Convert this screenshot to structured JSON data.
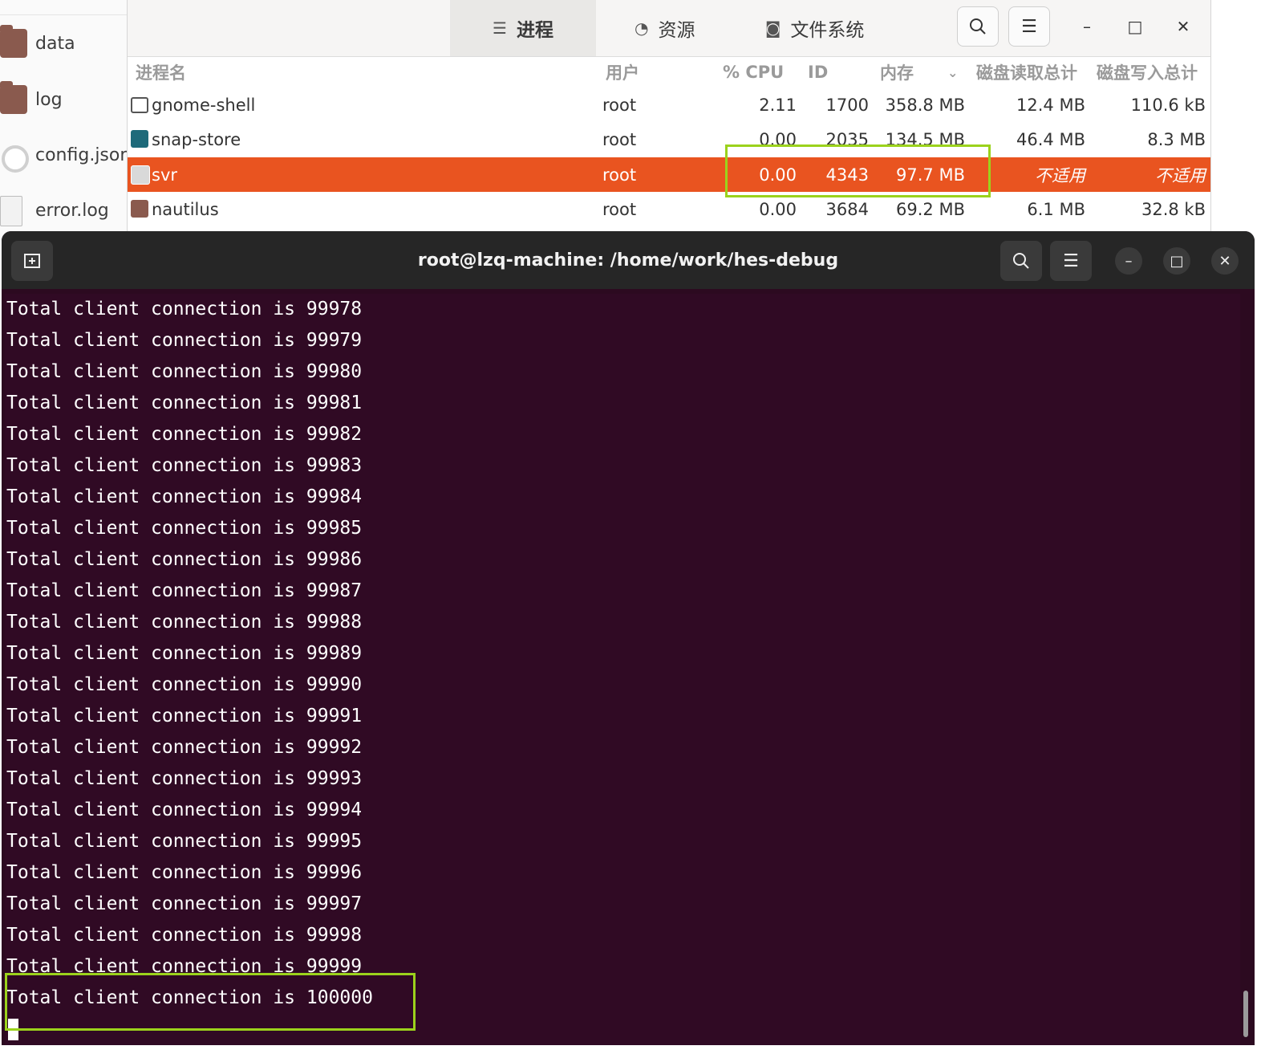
{
  "files": {
    "items": [
      {
        "name": "data",
        "icon": "folder-icon"
      },
      {
        "name": "log",
        "icon": "folder-icon"
      },
      {
        "name": "config.json",
        "icon": "json-file-icon"
      },
      {
        "name": "error.log",
        "icon": "log-file-icon"
      }
    ]
  },
  "system_monitor": {
    "tabs": [
      {
        "label": "进程",
        "icon": "list-icon",
        "active": true
      },
      {
        "label": "资源",
        "icon": "gauge-icon",
        "active": false
      },
      {
        "label": "文件系统",
        "icon": "disk-icon",
        "active": false
      }
    ],
    "buttons": {
      "search": "search-icon",
      "menu": "hamburger-menu-icon",
      "minimize": "–",
      "maximize": "□",
      "close": "✕"
    },
    "columns": {
      "name": "进程名",
      "user": "用户",
      "cpu": "% CPU",
      "id": "ID",
      "memory": "内存",
      "disk_read": "磁盘读取总计",
      "disk_write": "磁盘写入总计"
    },
    "sort_indicator": "chevron-down-icon",
    "processes": [
      {
        "name": "gnome-shell",
        "user": "root",
        "cpu": "2.11",
        "id": "1700",
        "memory": "358.8 MB",
        "disk_read": "12.4 MB",
        "disk_write": "110.6 kB",
        "selected": false
      },
      {
        "name": "snap-store",
        "user": "root",
        "cpu": "0.00",
        "id": "2035",
        "memory": "134.5 MB",
        "disk_read": "46.4 MB",
        "disk_write": "8.3 MB",
        "selected": false
      },
      {
        "name": "svr",
        "user": "root",
        "cpu": "0.00",
        "id": "4343",
        "memory": "97.7 MB",
        "disk_read": "不适用",
        "disk_write": "不适用",
        "selected": true
      },
      {
        "name": "nautilus",
        "user": "root",
        "cpu": "0.00",
        "id": "3684",
        "memory": "69.2 MB",
        "disk_read": "6.1 MB",
        "disk_write": "32.8 kB",
        "selected": false
      }
    ]
  },
  "terminal": {
    "title": "root@lzq-machine: /home/work/hes-debug",
    "buttons": {
      "new_tab": "new-tab-icon",
      "search": "search-icon",
      "menu": "hamburger-menu-icon",
      "minimize": "–",
      "maximize": "□",
      "close": "✕"
    },
    "lines": [
      "Total client connection is 99978",
      "Total client connection is 99979",
      "Total client connection is 99980",
      "Total client connection is 99981",
      "Total client connection is 99982",
      "Total client connection is 99983",
      "Total client connection is 99984",
      "Total client connection is 99985",
      "Total client connection is 99986",
      "Total client connection is 99987",
      "Total client connection is 99988",
      "Total client connection is 99989",
      "Total client connection is 99990",
      "Total client connection is 99991",
      "Total client connection is 99992",
      "Total client connection is 99993",
      "Total client connection is 99994",
      "Total client connection is 99995",
      "Total client connection is 99996",
      "Total client connection is 99997",
      "Total client connection is 99998",
      "Total client connection is 99999",
      "Total client connection is 100000"
    ]
  },
  "colors": {
    "selection": "#e95420",
    "highlight_box": "#9bd21c",
    "terminal_bg": "#300a24",
    "terminal_header": "#262626"
  }
}
